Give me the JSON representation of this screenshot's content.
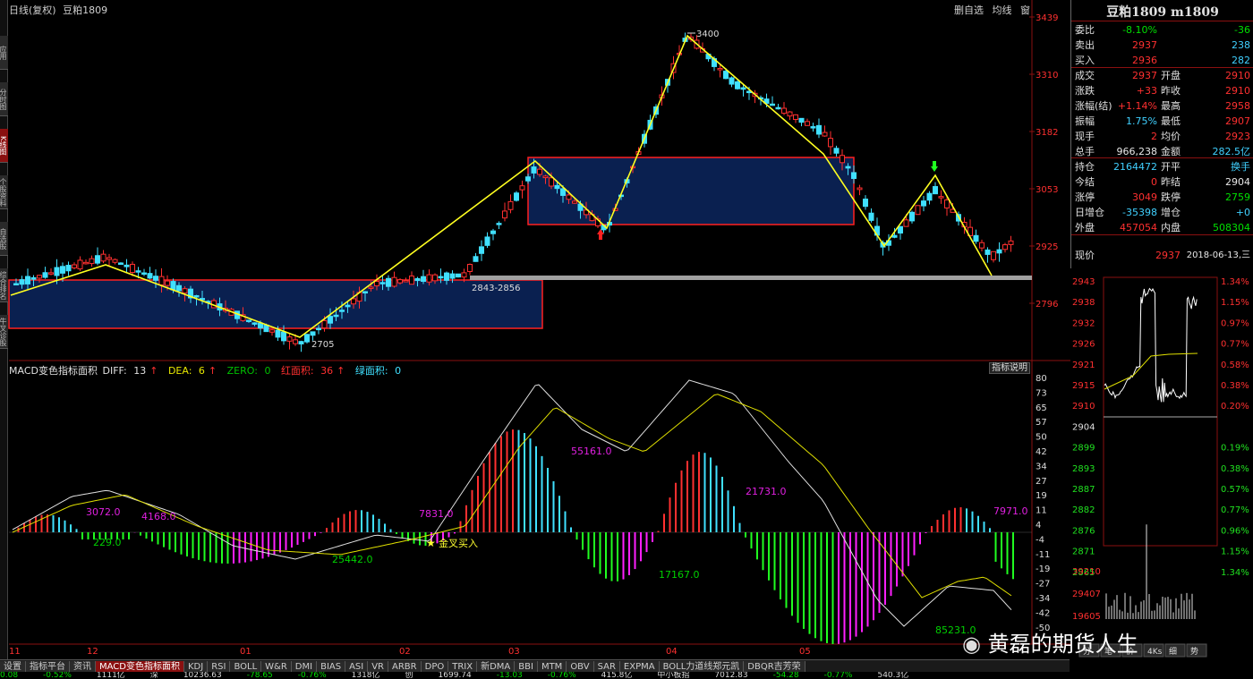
{
  "header": {
    "period": "日线(复权)",
    "symbol": "豆粕1809",
    "buttons": [
      "删自选",
      "均线",
      "窗"
    ]
  },
  "left_tabs": [
    "应用",
    "分时图",
    "K线图",
    "个股资料",
    "自选股",
    "综合排名",
    "牛叉诊股"
  ],
  "price_axis": [
    "3439",
    "3310",
    "3182",
    "3053",
    "2925",
    "2796"
  ],
  "annotations": {
    "high_label": "3400",
    "low_label": "2705",
    "range_label": "2843-2856",
    "golden_cross": "金叉买入"
  },
  "macd": {
    "title": "MACD变色指标面积",
    "diff_label": "DIFF:",
    "diff": "13",
    "dea_label": "DEA:",
    "dea": "6",
    "zero_label": "ZERO:",
    "zero": "0",
    "red_label": "红面积:",
    "red": "36",
    "green_label": "绿面积:",
    "green": "0",
    "help_button": "指标说明",
    "axis": [
      "80",
      "73",
      "65",
      "57",
      "50",
      "42",
      "34",
      "27",
      "19",
      "11",
      "4",
      "-4",
      "-11",
      "-19",
      "-27",
      "-34",
      "-42",
      "-50"
    ],
    "area_labels": [
      {
        "text": "3072.0",
        "color": "#e020e0"
      },
      {
        "text": "4168.0",
        "color": "#e020e0"
      },
      {
        "text": "229.0",
        "color": "#00d000"
      },
      {
        "text": "25442.0",
        "color": "#00d000"
      },
      {
        "text": "7831.0",
        "color": "#e020e0"
      },
      {
        "text": "55161.0",
        "color": "#e020e0"
      },
      {
        "text": "17167.0",
        "color": "#00d000"
      },
      {
        "text": "21731.0",
        "color": "#e020e0"
      },
      {
        "text": "85231.0",
        "color": "#00d000"
      },
      {
        "text": "7971.0",
        "color": "#e020e0"
      }
    ]
  },
  "time_axis": [
    "11",
    "12",
    "01",
    "02",
    "03",
    "04",
    "05"
  ],
  "bottom_tabs": [
    "设置",
    "指标平台",
    "资讯",
    "MACD变色指标面积",
    "KDJ",
    "RSI",
    "BOLL",
    "W&R",
    "DMI",
    "BIAS",
    "ASI",
    "VR",
    "ARBR",
    "DPO",
    "TRIX",
    "新DMA",
    "BBI",
    "MTM",
    "OBV",
    "SAR",
    "EXPMA",
    "BOLL力道线郑元凯",
    "DBQR吉芳荣"
  ],
  "status_bar": [
    {
      "text": "0.08",
      "c": "g"
    },
    {
      "text": "-0.52%",
      "c": "g"
    },
    {
      "text": "1111亿",
      "c": "w"
    },
    {
      "text": "深",
      "c": "w"
    },
    {
      "text": "10236.63",
      "c": "w"
    },
    {
      "text": "-78.65",
      "c": "g"
    },
    {
      "text": "-0.76%",
      "c": "g"
    },
    {
      "text": "1318亿",
      "c": "w"
    },
    {
      "text": "创",
      "c": "w"
    },
    {
      "text": "1699.74",
      "c": "w"
    },
    {
      "text": "-13.03",
      "c": "g"
    },
    {
      "text": "-0.76%",
      "c": "g"
    },
    {
      "text": "415.8亿",
      "c": "w"
    },
    {
      "text": "中小板指",
      "c": "w"
    },
    {
      "text": "7012.83",
      "c": "w"
    },
    {
      "text": "-54.28",
      "c": "g"
    },
    {
      "text": "-0.77%",
      "c": "g"
    },
    {
      "text": "540.3亿",
      "c": "w"
    }
  ],
  "quote": {
    "title": "豆粕1809 m1809",
    "rows": [
      {
        "k": "委比",
        "v": "-8.10%",
        "vc": "green",
        "k2": "",
        "v2": "-36",
        "v2c": "green"
      },
      {
        "k": "卖出",
        "v": "2937",
        "vc": "red",
        "k2": "",
        "v2": "238",
        "v2c": "cyan"
      },
      {
        "k": "买入",
        "v": "2936",
        "vc": "red",
        "k2": "",
        "v2": "282",
        "v2c": "cyan"
      },
      {
        "k": "成交",
        "v": "2937",
        "vc": "red",
        "k2": "开盘",
        "v2": "2910",
        "v2c": "red"
      },
      {
        "k": "涨跌",
        "v": "+33",
        "vc": "red",
        "k2": "昨收",
        "v2": "2910",
        "v2c": "red"
      },
      {
        "k": "涨幅(结)",
        "v": "+1.14%",
        "vc": "red",
        "k2": "最高",
        "v2": "2958",
        "v2c": "red"
      },
      {
        "k": "振幅",
        "v": "1.75%",
        "vc": "cyan",
        "k2": "最低",
        "v2": "2907",
        "v2c": "red"
      },
      {
        "k": "现手",
        "v": "2",
        "vc": "red",
        "k2": "均价",
        "v2": "2923",
        "v2c": "red"
      },
      {
        "k": "总手",
        "v": "966,238",
        "vc": "white",
        "k2": "金额",
        "v2": "282.5亿",
        "v2c": "cyan"
      },
      {
        "k": "持仓",
        "v": "2164472",
        "vc": "cyan",
        "k2": "开平",
        "v2": "换手",
        "v2c": "cyan"
      },
      {
        "k": "今结",
        "v": "0",
        "vc": "red",
        "k2": "昨结",
        "v2": "2904",
        "v2c": "white"
      },
      {
        "k": "涨停",
        "v": "3049",
        "vc": "red",
        "k2": "跌停",
        "v2": "2759",
        "v2c": "green"
      },
      {
        "k": "日增仓",
        "v": "-35398",
        "vc": "cyan",
        "k2": "增仓",
        "v2": "+0",
        "v2c": "cyan"
      },
      {
        "k": "外盘",
        "v": "457054",
        "vc": "red",
        "k2": "内盘",
        "v2": "508304",
        "v2c": "green"
      }
    ],
    "price_label": "现价",
    "price": "2937",
    "date": "2018-06-13,三"
  },
  "mini": {
    "left_axis": [
      "2943",
      "2938",
      "2932",
      "2926",
      "2921",
      "2915",
      "2910",
      "2904",
      "2899",
      "2893",
      "2887",
      "2882",
      "2876",
      "2871",
      "2865"
    ],
    "right_axis": [
      "1.34%",
      "1.15%",
      "0.97%",
      "0.77%",
      "0.58%",
      "0.38%",
      "0.20%",
      "",
      "0.19%",
      "0.38%",
      "0.57%",
      "0.77%",
      "0.96%",
      "1.15%",
      "1.34%"
    ],
    "vol_axis": [
      "39210",
      "29407",
      "19605"
    ],
    "tabs": [
      "分",
      "笔",
      "价",
      "4Ks",
      "细",
      "势"
    ]
  },
  "watermark": "黄磊的期货人生"
}
